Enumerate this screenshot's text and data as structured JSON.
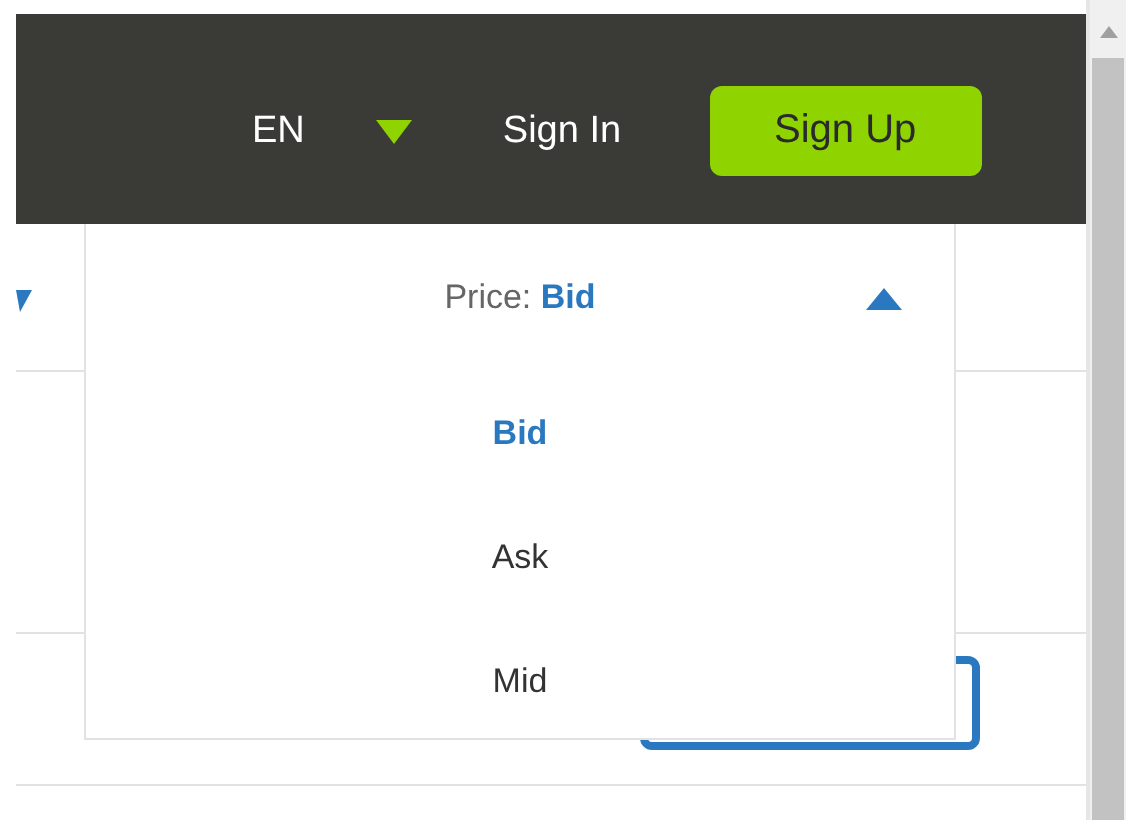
{
  "header": {
    "language": "EN",
    "sign_in": "Sign In",
    "sign_up": "Sign Up"
  },
  "price_dropdown": {
    "label": "Price:",
    "value": "Bid",
    "expanded": true,
    "options": [
      {
        "label": "Bid",
        "selected": true
      },
      {
        "label": "Ask",
        "selected": false
      },
      {
        "label": "Mid",
        "selected": false
      }
    ]
  }
}
